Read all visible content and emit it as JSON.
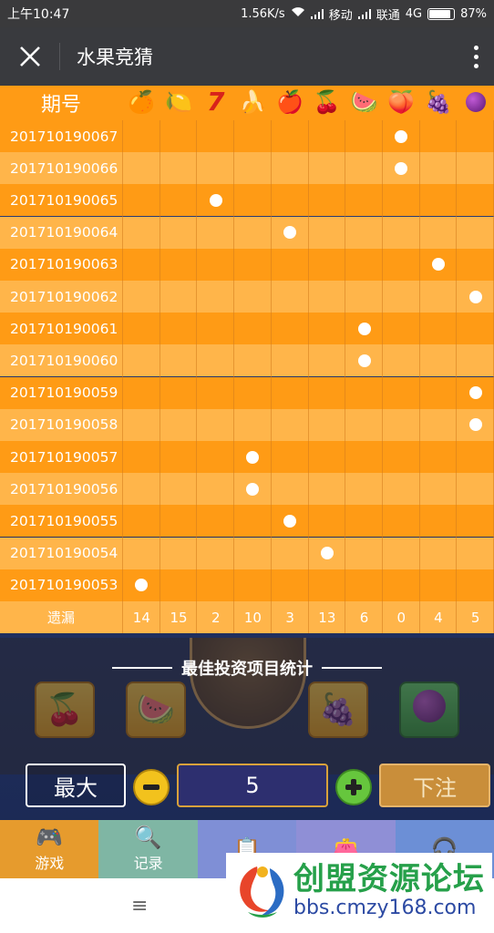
{
  "status_bar": {
    "time": "上午10:47",
    "speed": "1.56K/s",
    "carrier1": "移动",
    "carrier2": "联通",
    "network": "4G",
    "battery": "87%",
    "battery_level": 0.87
  },
  "title_bar": {
    "title": "水果竞猜"
  },
  "chart_data": {
    "type": "table",
    "header_label": "期号",
    "fruits": [
      {
        "name": "orange",
        "glyph": "🍊"
      },
      {
        "name": "lemon",
        "glyph": "🍋"
      },
      {
        "name": "seven",
        "glyph": "7"
      },
      {
        "name": "banana",
        "glyph": "🍌"
      },
      {
        "name": "apple",
        "glyph": "🍎"
      },
      {
        "name": "cherry",
        "glyph": "🍒"
      },
      {
        "name": "watermelon",
        "glyph": "🍉"
      },
      {
        "name": "peach",
        "glyph": "🍑"
      },
      {
        "name": "grape",
        "glyph": "🍇"
      },
      {
        "name": "plum",
        "glyph": "🟣"
      }
    ],
    "rows": [
      {
        "period": "201710190067",
        "hit": 7
      },
      {
        "period": "201710190066",
        "hit": 7
      },
      {
        "period": "201710190065",
        "hit": 2
      },
      {
        "period": "201710190064",
        "hit": 4
      },
      {
        "period": "201710190063",
        "hit": 8
      },
      {
        "period": "201710190062",
        "hit": 9
      },
      {
        "period": "201710190061",
        "hit": 6
      },
      {
        "period": "201710190060",
        "hit": 6
      },
      {
        "period": "201710190059",
        "hit": 9
      },
      {
        "period": "201710190058",
        "hit": 9
      },
      {
        "period": "201710190057",
        "hit": 3
      },
      {
        "period": "201710190056",
        "hit": 3
      },
      {
        "period": "201710190055",
        "hit": 4
      },
      {
        "period": "201710190054",
        "hit": 5
      },
      {
        "period": "201710190053",
        "hit": 0
      }
    ],
    "missing_label": "遗漏",
    "missing": [
      "14",
      "15",
      "2",
      "10",
      "3",
      "13",
      "6",
      "0",
      "4",
      "5"
    ]
  },
  "game": {
    "stats_title": "最佳投资项目统计",
    "fruit_buttons": [
      {
        "name": "cherry",
        "glyph": "🍒"
      },
      {
        "name": "watermelon",
        "glyph": "🍉"
      },
      {
        "name": "grape",
        "glyph": "🍇"
      },
      {
        "name": "plum",
        "glyph": "🟣"
      }
    ]
  },
  "controls": {
    "max_label": "最大",
    "bet_value": "5",
    "bet_label": "下注"
  },
  "bottom_nav": {
    "items": [
      {
        "label": "游戏",
        "icon": "gamepad-icon",
        "glyph": "🎮"
      },
      {
        "label": "记录",
        "icon": "search-icon",
        "glyph": "🔍"
      },
      {
        "label": "",
        "icon": "notes-icon",
        "glyph": "📋"
      },
      {
        "label": "",
        "icon": "wallet-icon",
        "glyph": "👛"
      },
      {
        "label": "",
        "icon": "headset-icon",
        "glyph": "🎧"
      }
    ]
  },
  "system_bar": {
    "menu_glyph": "≡"
  },
  "watermark": {
    "title": "创盟资源论坛",
    "url": "bbs.cmzy168.com"
  }
}
